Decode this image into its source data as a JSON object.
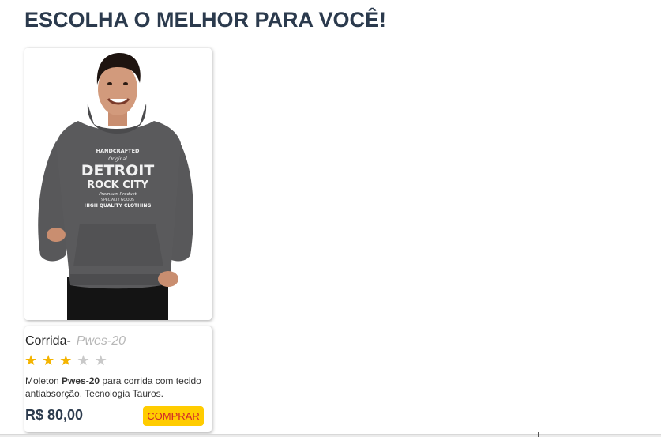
{
  "section": {
    "title": "ESCOLHA O MELHOR PARA VOCÊ!"
  },
  "product": {
    "name": "Corrida-",
    "model": "Pwes-20",
    "rating": {
      "value": 3,
      "max": 5
    },
    "description": {
      "prefix": "Moleton ",
      "bold": "Pwes-20",
      "suffix": " para corrida com tecido antiabsorção. Tecnologia Tauros."
    },
    "price": "R$ 80,00",
    "buy_label": "COMPRAR",
    "image": {
      "alt": "man-in-gray-hoodie-photo",
      "graphic_lines": [
        "HANDCRAFTED",
        "Original",
        "DETROIT",
        "ROCK CITY",
        "Premium Product",
        "SPECIALTY GOODS",
        "HIGH QUALITY CLOTHING"
      ]
    }
  },
  "colors": {
    "title": "#2b3a4d",
    "star_on": "#f4b400",
    "star_off": "#c9c9c9",
    "button_bg": "#ffcc00",
    "button_text": "#d0242a",
    "hoodie": "#5a5a5c"
  }
}
